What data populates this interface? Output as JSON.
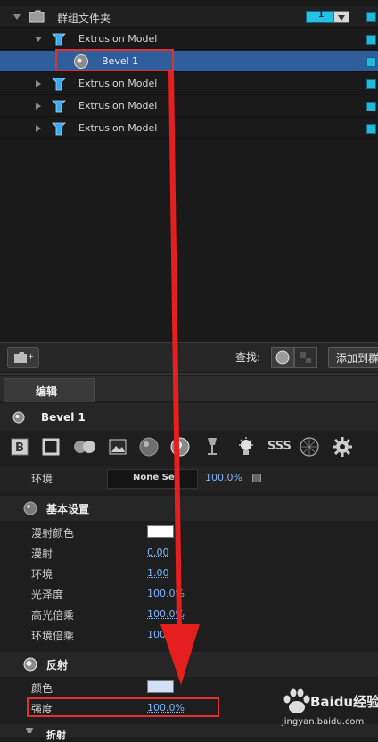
{
  "tree": {
    "group_label": "群组文件夹",
    "group_counter": "1",
    "items": [
      {
        "label": "Extrusion Model"
      },
      {
        "label": "Bevel 1"
      },
      {
        "label": "Extrusion Model"
      },
      {
        "label": "Extrusion Model"
      },
      {
        "label": "Extrusion Model"
      }
    ]
  },
  "bottombar": {
    "search_label": "查找:",
    "add_button": "添加到群"
  },
  "panel": {
    "tab_edit": "编辑",
    "object_name": "Bevel 1",
    "env_row": {
      "label": "环境",
      "dropdown": "None Set",
      "percent": "100.0%"
    },
    "basic_section": {
      "title": "基本设置",
      "rows": [
        {
          "label": "漫射颜色",
          "value": ""
        },
        {
          "label": "漫射",
          "value": "0.00"
        },
        {
          "label": "环境",
          "value": "1.00"
        },
        {
          "label": "光泽度",
          "value": "100.0%"
        },
        {
          "label": "高光倍乘",
          "value": "100.0%"
        },
        {
          "label": "环境倍乘",
          "value": "100.0%"
        }
      ]
    },
    "reflect_section": {
      "title": "反射",
      "rows": [
        {
          "label": "颜色",
          "value": ""
        },
        {
          "label": "强度",
          "value": "100.0%"
        }
      ]
    },
    "cut_label": "折射"
  },
  "toolbar_icons": [
    "b-icon",
    "shield-icon",
    "pill-icon",
    "image-icon",
    "sphere-icon",
    "ball-icon",
    "glass-icon",
    "bulb-icon",
    "sss-icon",
    "mesh-icon",
    "gear-icon"
  ],
  "watermark": {
    "brand": "Baidu经验",
    "url": "jingyan.baidu.com"
  },
  "colors": {
    "selection": "#2f5e9c",
    "accent": "#23b7d9",
    "highlight_box": "#e03030",
    "arrow": "#e51e1e"
  }
}
